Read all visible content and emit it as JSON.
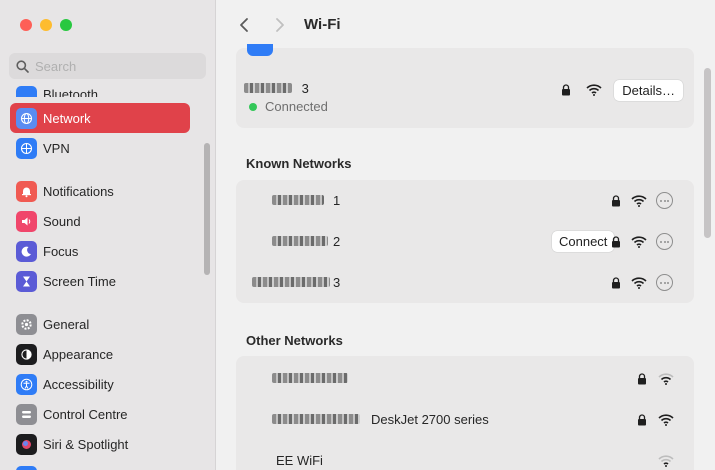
{
  "window": {
    "title": "Wi-Fi"
  },
  "sidebar": {
    "search_placeholder": "Search",
    "items": [
      {
        "label": "Bluetooth",
        "icon": "bluetooth-icon",
        "color": "#2f7cf6",
        "active": false
      },
      {
        "label": "Network",
        "icon": "globe-icon",
        "color": "#2f7cf6",
        "active": true
      },
      {
        "label": "VPN",
        "icon": "vpn-icon",
        "color": "#2f7cf6",
        "active": false
      },
      {
        "label": "Notifications",
        "icon": "bell-icon",
        "color": "#f05a52",
        "active": false
      },
      {
        "label": "Sound",
        "icon": "speaker-icon",
        "color": "#f0466b",
        "active": false
      },
      {
        "label": "Focus",
        "icon": "moon-icon",
        "color": "#5b5bd6",
        "active": false
      },
      {
        "label": "Screen Time",
        "icon": "hourglass-icon",
        "color": "#5b5bd6",
        "active": false
      },
      {
        "label": "General",
        "icon": "gear-icon",
        "color": "#8e8e93",
        "active": false
      },
      {
        "label": "Appearance",
        "icon": "appearance-icon",
        "color": "#1c1c1e",
        "active": false
      },
      {
        "label": "Accessibility",
        "icon": "accessibility-icon",
        "color": "#2f7cf6",
        "active": false
      },
      {
        "label": "Control Centre",
        "icon": "control-centre-icon",
        "color": "#8e8e93",
        "active": false
      },
      {
        "label": "Siri & Spotlight",
        "icon": "siri-icon",
        "color": "#1c1c1e",
        "active": false
      }
    ]
  },
  "current_network": {
    "name_suffix": "3",
    "status": "Connected",
    "details_label": "Details…"
  },
  "known_networks": {
    "title": "Known Networks",
    "rows": [
      {
        "name_suffix": "1",
        "has_connect": false
      },
      {
        "name_suffix": "2",
        "has_connect": true
      },
      {
        "name_suffix": "3",
        "has_connect": false
      }
    ],
    "connect_label": "Connect"
  },
  "other_networks": {
    "title": "Other Networks",
    "rows": [
      {
        "name": "",
        "locked": true
      },
      {
        "name": "DeskJet 2700 series",
        "locked": true
      },
      {
        "name": "EE WiFi",
        "locked": false
      }
    ]
  },
  "colors": {
    "accent_active": "#e0424a",
    "connected_green": "#34c759",
    "toggle_blue": "#2f7cf6"
  }
}
